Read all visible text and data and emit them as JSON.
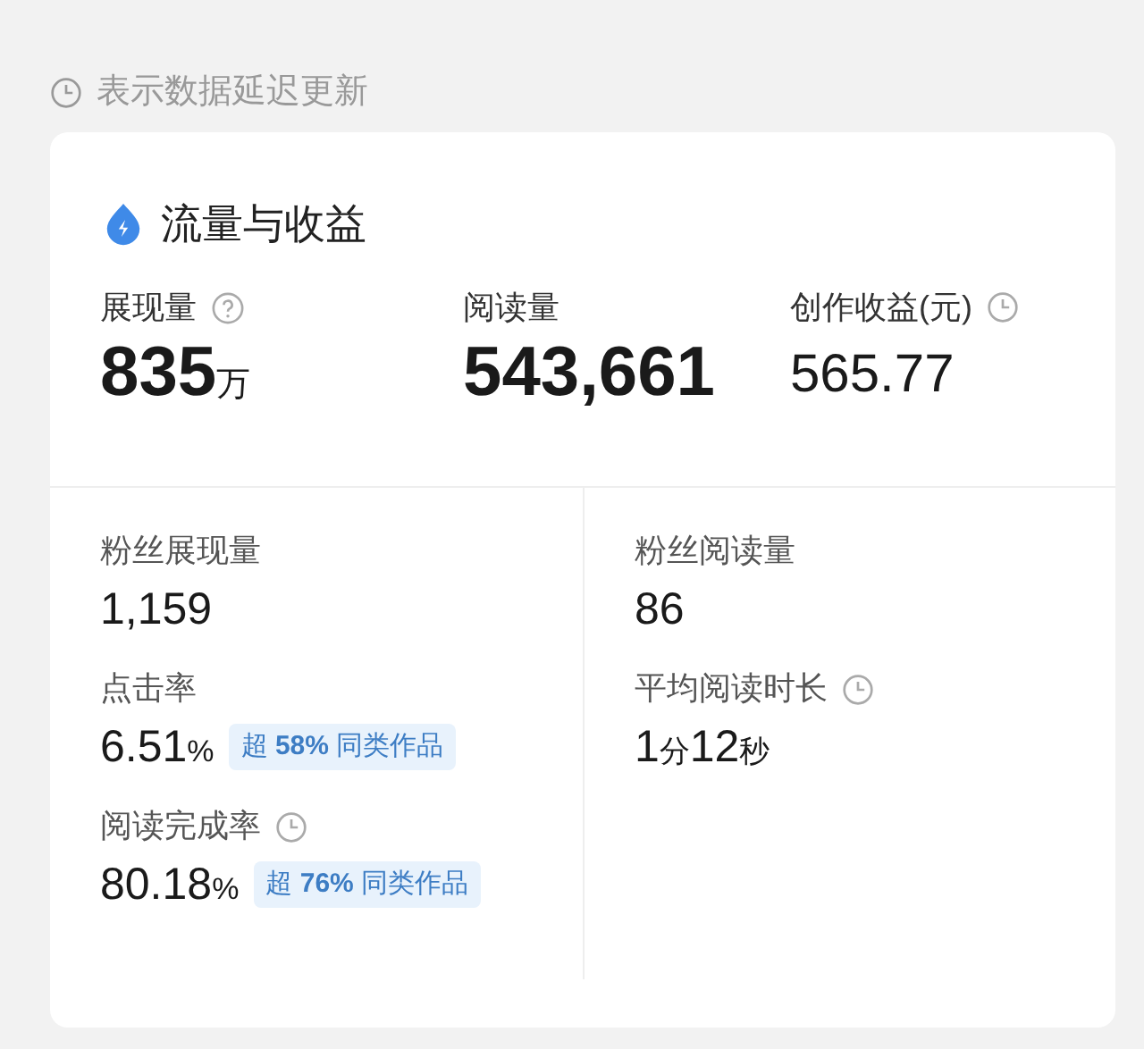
{
  "notice": {
    "text": "表示数据延迟更新"
  },
  "card": {
    "title": "流量与收益",
    "top_metrics": [
      {
        "label": "展现量",
        "has_help": true,
        "value": [
          {
            "text": "835",
            "kind": "number"
          },
          {
            "text": "万",
            "kind": "unit"
          }
        ]
      },
      {
        "label": "阅读量",
        "value": [
          {
            "text": "543,661",
            "kind": "number"
          }
        ]
      },
      {
        "label": "创作收益(元)",
        "delayed": true,
        "value": [
          {
            "text": "565.77",
            "kind": "number"
          }
        ]
      }
    ],
    "sub_columns": [
      [
        {
          "label": "粉丝展现量",
          "value": [
            {
              "text": "1,159",
              "kind": "number"
            }
          ]
        },
        {
          "label": "点击率",
          "value": [
            {
              "text": "6.51",
              "kind": "number"
            },
            {
              "text": "%",
              "kind": "unit"
            }
          ],
          "badge": "超 **58%** 同类作品"
        },
        {
          "label": "阅读完成率",
          "delayed": true,
          "value": [
            {
              "text": "80.18",
              "kind": "number"
            },
            {
              "text": "%",
              "kind": "unit"
            }
          ],
          "badge": "超 **76%** 同类作品"
        }
      ],
      [
        {
          "label": "粉丝阅读量",
          "value": [
            {
              "text": "86",
              "kind": "number"
            }
          ]
        },
        {
          "label": "平均阅读时长",
          "delayed": true,
          "value": [
            {
              "text": "1",
              "kind": "number"
            },
            {
              "text": "分",
              "kind": "unit"
            },
            {
              "text": "12",
              "kind": "number"
            },
            {
              "text": "秒",
              "kind": "unit"
            }
          ]
        }
      ]
    ]
  }
}
